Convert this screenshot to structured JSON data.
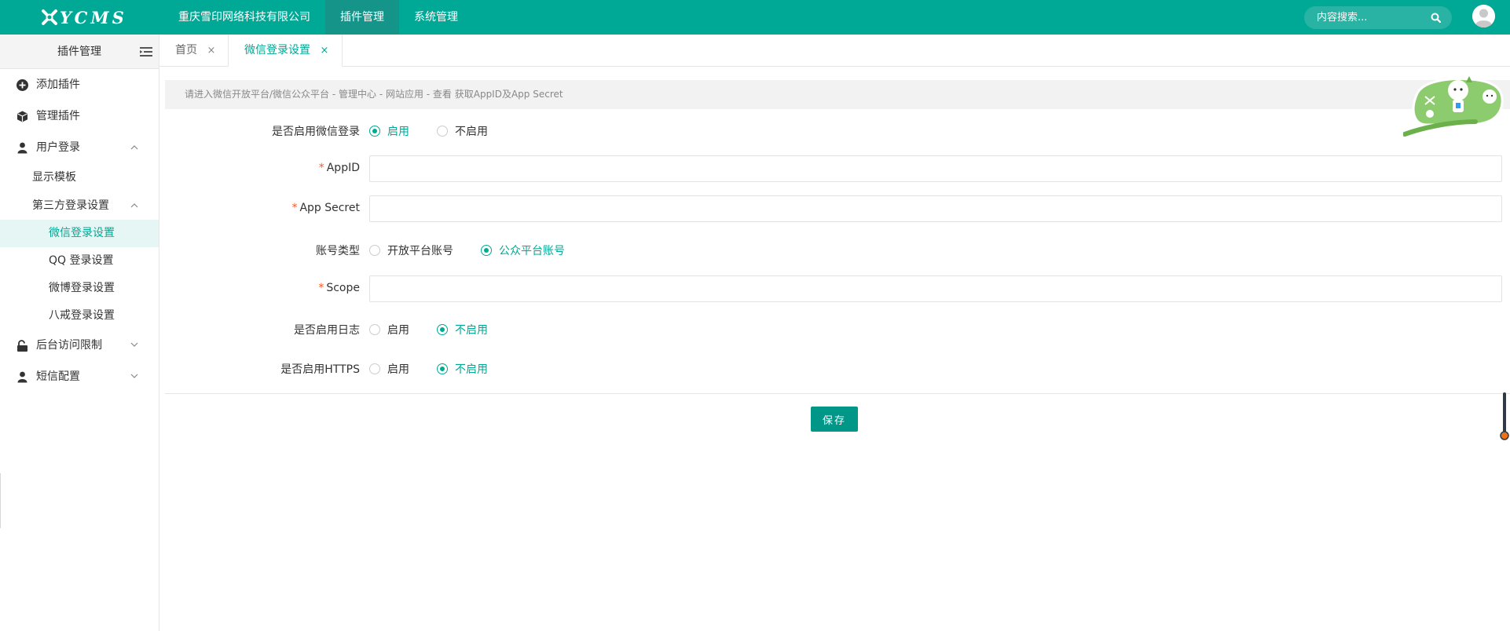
{
  "header": {
    "logo_text": "YCMS",
    "nav": [
      {
        "label": "重庆雪印网络科技有限公司",
        "active": false
      },
      {
        "label": "插件管理",
        "active": true
      },
      {
        "label": "系统管理",
        "active": false
      }
    ],
    "search_placeholder": "内容搜索..."
  },
  "sidebar": {
    "title": "插件管理",
    "items": {
      "add_plugin": "添加插件",
      "manage_plugin": "管理插件",
      "user_login": "用户登录",
      "display_template": "显示模板",
      "third_party": "第三方登录设置",
      "wechat": "微信登录设置",
      "qq": "QQ 登录设置",
      "weibo": "微博登录设置",
      "bajie": "八戒登录设置",
      "backend_access": "后台访问限制",
      "sms": "短信配置"
    }
  },
  "tabs": [
    {
      "label": "首页",
      "close": "×",
      "active": false
    },
    {
      "label": "微信登录设置",
      "close": "×",
      "active": true
    }
  ],
  "form": {
    "notice": "请进入微信开放平台/微信公众平台 - 管理中心 - 网站应用 - 查看 获取AppID及App Secret",
    "enable_wechat": {
      "label": "是否启用微信登录",
      "options": [
        "启用",
        "不启用"
      ],
      "selected": "启用"
    },
    "appid": {
      "label": "AppID",
      "required_mark": "*",
      "value": ""
    },
    "app_secret": {
      "label": "App Secret",
      "required_mark": "*",
      "value": ""
    },
    "account_type": {
      "label": "账号类型",
      "options": [
        "开放平台账号",
        "公众平台账号"
      ],
      "selected": "公众平台账号"
    },
    "scope": {
      "label": "Scope",
      "required_mark": "*",
      "value": ""
    },
    "enable_log": {
      "label": "是否启用日志",
      "options": [
        "启用",
        "不启用"
      ],
      "selected": "不启用"
    },
    "enable_https": {
      "label": "是否启用HTTPS",
      "options": [
        "启用",
        "不启用"
      ],
      "selected": "不启用"
    },
    "save_label": "保存"
  },
  "colors": {
    "primary": "#00A996",
    "nav_active": "#15948A",
    "button": "#009688",
    "required": "#FF5722"
  }
}
